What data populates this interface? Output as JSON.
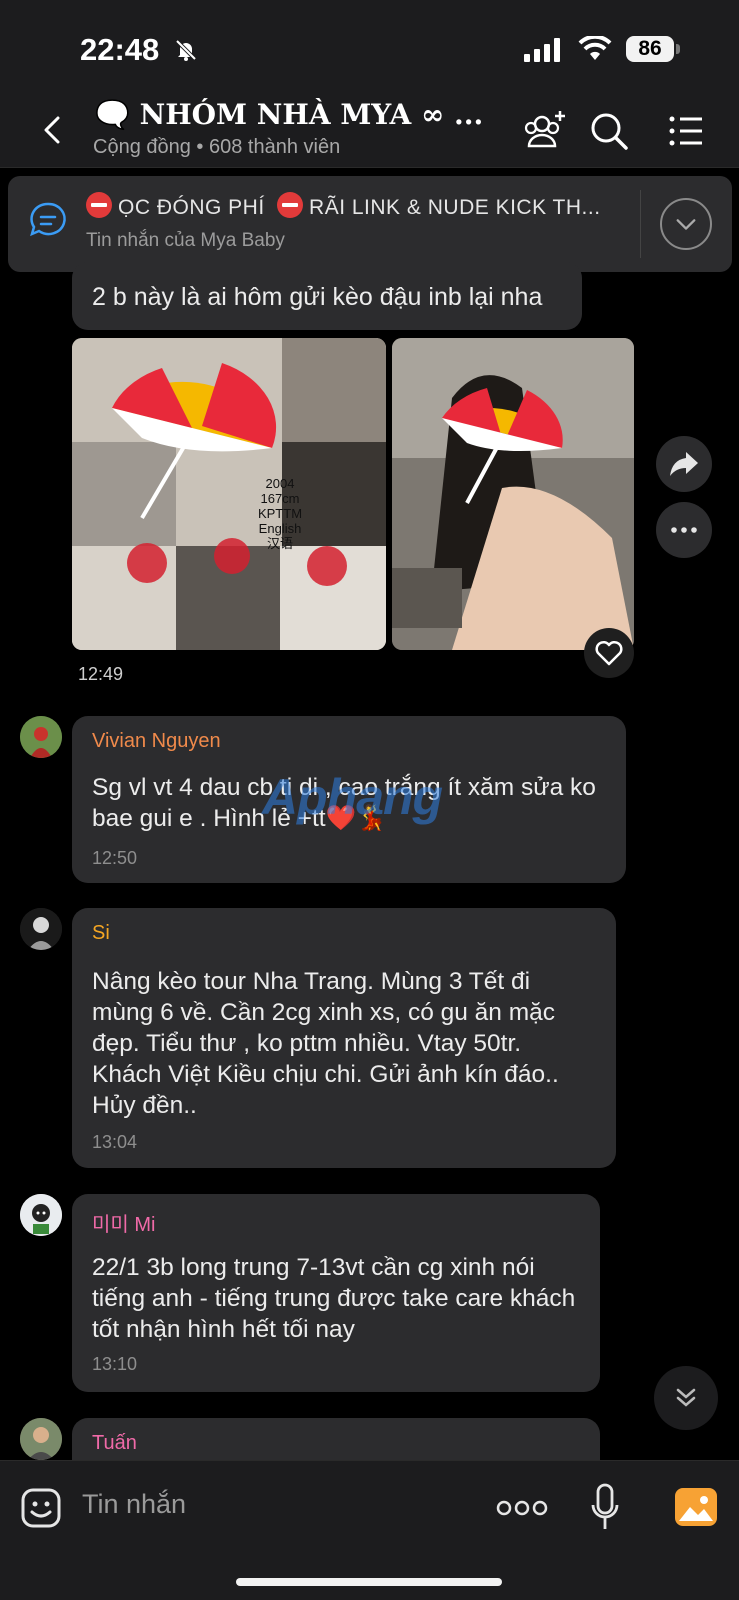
{
  "status_bar": {
    "time": "22:48",
    "battery": "86"
  },
  "header": {
    "title": "🗨️ NHÓM NHÀ MYA ∞ ...",
    "subtitle": "Cộng đồng • 608 thành viên"
  },
  "pinned": {
    "text": "ỌC ĐÓNG PHÍ",
    "text2": "RÃI LINK & NUDE KICK TH...",
    "sub": "Tin nhắn của Mya Baby"
  },
  "messages": [
    {
      "text": "2 b này là ai hôm gửi kèo đậu inb lại nha"
    },
    {
      "photo_overlay": [
        "2004",
        "167cm",
        "KPTTM",
        "English",
        "汉语"
      ],
      "time": "12:49"
    },
    {
      "sender": "Vivian Nguyen",
      "sender_color": "#f08a4b",
      "text": "Sg vl vt 4 dau cb ti di , cao trắng ít xăm sửa ko bae gui e . Hình lẻ +tt❤️💃",
      "time": "12:50"
    },
    {
      "sender": "Si",
      "sender_color": "#f5a623",
      "text": "Nâng kèo tour Nha Trang. Mùng 3 Tết đi mùng 6 về. Cần 2cg xinh xs, có gu ăn mặc đẹp. Tiểu thư , ko pttm nhiều. Vtay 50tr. Khách Việt Kiều chịu chi. Gửi ảnh kín đáo.. Hủy đền..",
      "time": "13:04"
    },
    {
      "sender": "미미 Mi",
      "sender_color": "#f06aa8",
      "text": "22/1 3b long trung 7-13vt cần cg xinh nói tiếng anh - tiếng trung được take care khách tốt nhận hình hết tối nay",
      "time": "13:10"
    },
    {
      "sender": "Tuấn",
      "sender_color": "#f06aa8"
    }
  ],
  "watermark": "Aphang",
  "input": {
    "placeholder": "Tin nhắn"
  }
}
